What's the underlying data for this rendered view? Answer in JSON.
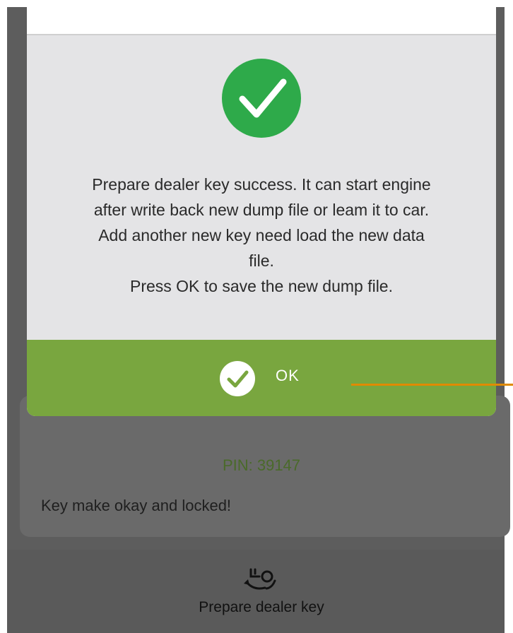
{
  "dialog": {
    "icon": "success-check-icon",
    "message_lines": [
      "Prepare dealer key success. It can start engine",
      "after write back new dump file or leam it to car.",
      "Add another new key need load the new data",
      "file.",
      "Press OK to save the new dump file."
    ],
    "ok_button": {
      "label": "OK",
      "icon": "check-circle-icon"
    }
  },
  "result": {
    "pin": "PIN: 39147",
    "status": "Key make okay and locked!"
  },
  "bottom_nav": {
    "label": "Prepare dealer key",
    "icon": "key-swap-icon"
  },
  "colors": {
    "success_green": "#2eaa4a",
    "ok_bar": "#79a63f",
    "pin_text": "#4a6a2a",
    "callout": "#e08a00",
    "overlay": "#5d5d5d"
  }
}
